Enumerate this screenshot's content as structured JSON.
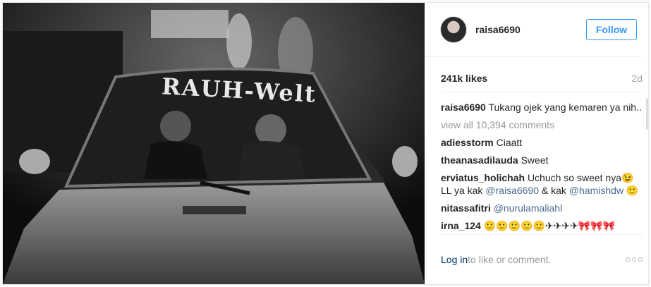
{
  "post": {
    "username": "raisa6690",
    "follow_label": "Follow",
    "likes": "241k likes",
    "age": "2d",
    "windshield_text": "RAUH-Welt",
    "caption": {
      "user": "raisa6690",
      "text": "Tukang ojek yang kemaren ya nih.."
    },
    "view_all": "view all 10,394 comments",
    "comments": [
      {
        "user": "adiesstorm",
        "text": "Ciaatt"
      },
      {
        "user": "theanasadilauda",
        "text": "Sweet"
      },
      {
        "user": "erviatus_holichah",
        "text": "Uchuch so sweet nya😉 LL ya kak ",
        "mention1": "@raisa6690",
        "mid": " & kak ",
        "mention2": "@hamishdw",
        "end": " 🙂"
      },
      {
        "user": "nitassafitri",
        "mention": "@nurulamaliahl"
      },
      {
        "user": "irna_124",
        "text": "🙂🙂🙂🙂🙂✈✈✈✈🎀🎀🎀"
      }
    ],
    "footer": {
      "login_label": "Log in",
      "rest": " to like or comment."
    }
  }
}
